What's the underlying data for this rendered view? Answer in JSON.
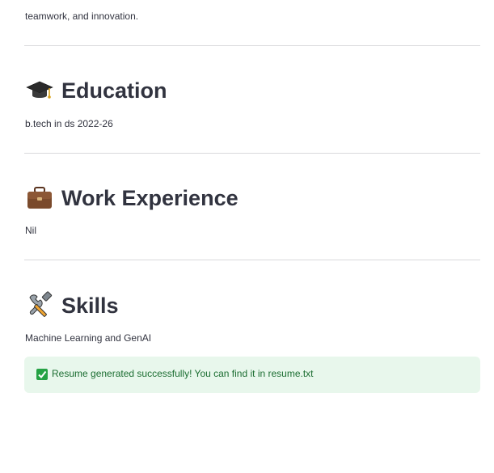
{
  "intro": {
    "partial_line": "teamwork, and innovation."
  },
  "sections": [
    {
      "icon": "graduation-cap-icon",
      "title": "Education",
      "body": "b.tech in ds 2022-26"
    },
    {
      "icon": "briefcase-icon",
      "title": "Work Experience",
      "body": "Nil"
    },
    {
      "icon": "tools-icon",
      "title": "Skills",
      "body": "Machine Learning and GenAI"
    }
  ],
  "alert": {
    "icon": "check-box-icon",
    "message": "Resume generated successfully! You can find it in resume.txt",
    "color": "#1b6d31",
    "background": "#e8f7ec"
  }
}
